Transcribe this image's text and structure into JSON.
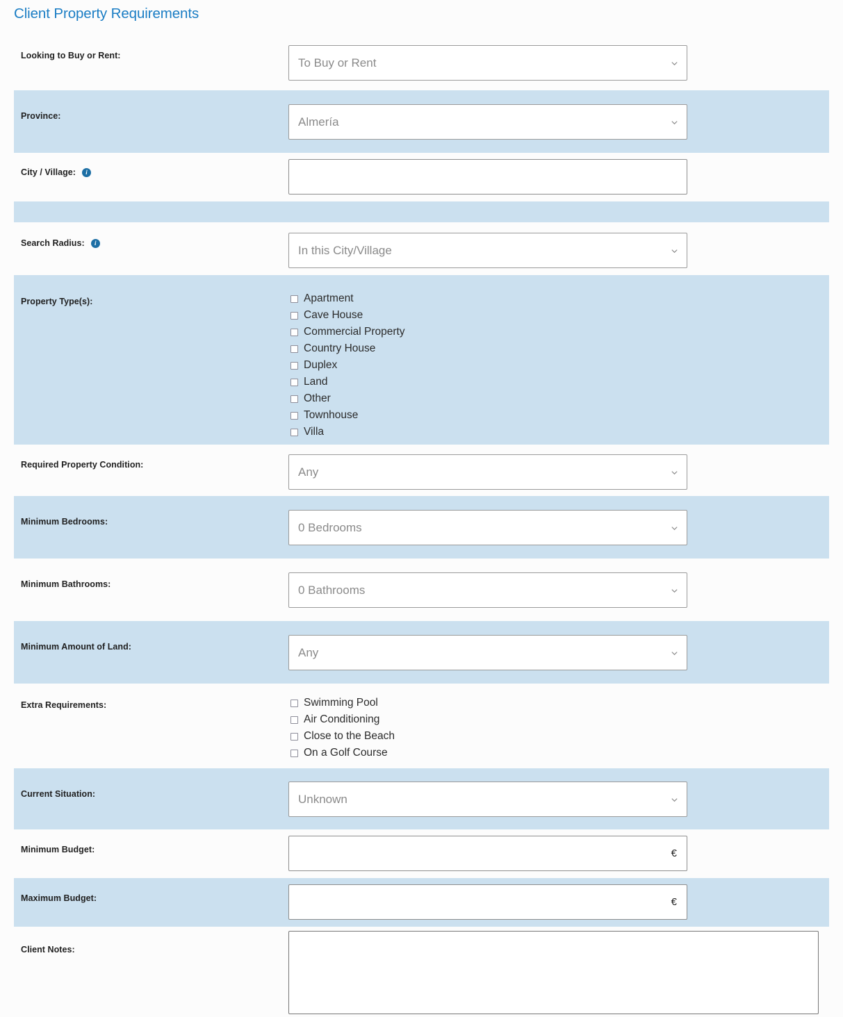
{
  "title": "Client Property Requirements",
  "theme": {
    "title_color": "#1a7dc4",
    "shaded_row_color": "#cbe0ef",
    "page_background": "#fcfcfc",
    "label_color": "#1f1f1f",
    "placeholder_color": "#8a8a8a"
  },
  "fields": {
    "buy_or_rent": {
      "label": "Looking to Buy or Rent:",
      "value": "To Buy or Rent"
    },
    "province": {
      "label": "Province:",
      "value": "Almería"
    },
    "city_village": {
      "label": "City / Village:",
      "value": "",
      "info": "i"
    },
    "search_radius": {
      "label": "Search Radius:",
      "value": "In this City/Village",
      "info": "i"
    },
    "property_types": {
      "label": "Property Type(s):",
      "options": [
        "Apartment",
        "Cave House",
        "Commercial Property",
        "Country House",
        "Duplex",
        "Land",
        "Other",
        "Townhouse",
        "Villa"
      ]
    },
    "property_condition": {
      "label": "Required Property Condition:",
      "value": "Any"
    },
    "min_bedrooms": {
      "label": "Minimum Bedrooms:",
      "value": "0 Bedrooms"
    },
    "min_bathrooms": {
      "label": "Minimum Bathrooms:",
      "value": "0 Bathrooms"
    },
    "min_land": {
      "label": "Minimum Amount of Land:",
      "value": "Any"
    },
    "extra_requirements": {
      "label": "Extra Requirements:",
      "options": [
        "Swimming Pool",
        "Air Conditioning",
        "Close to the Beach",
        "On a Golf Course"
      ]
    },
    "current_situation": {
      "label": "Current Situation:",
      "value": "Unknown"
    },
    "min_budget": {
      "label": "Minimum Budget:",
      "value": "",
      "currency": "€"
    },
    "max_budget": {
      "label": "Maximum Budget:",
      "value": "",
      "currency": "€"
    },
    "client_notes": {
      "label": "Client Notes:",
      "value": ""
    }
  }
}
